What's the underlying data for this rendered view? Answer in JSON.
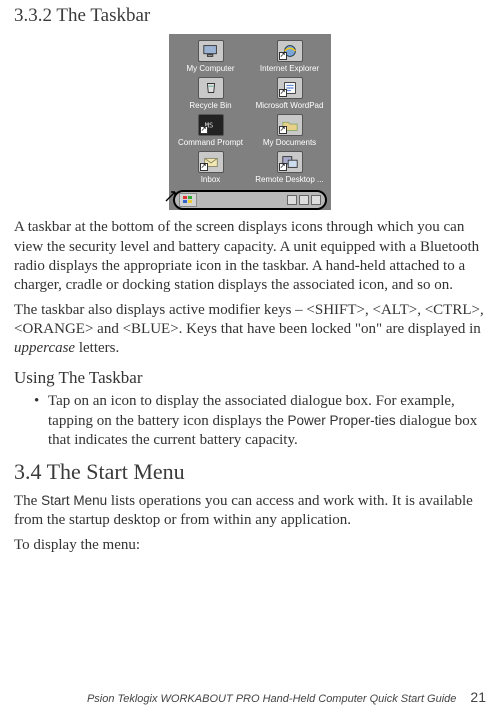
{
  "section332": {
    "heading": "3.3.2 The Taskbar",
    "screenshot": {
      "icons": [
        {
          "label": "My Computer",
          "glyph": "computer"
        },
        {
          "label": "Internet Explorer",
          "glyph": "ie"
        },
        {
          "label": "Recycle Bin",
          "glyph": "recycle"
        },
        {
          "label": "Microsoft WordPad",
          "glyph": "wordpad"
        },
        {
          "label": "Command Prompt",
          "glyph": "cmd"
        },
        {
          "label": "My Documents",
          "glyph": "folder"
        },
        {
          "label": "Inbox",
          "glyph": "inbox"
        },
        {
          "label": "Remote Desktop ...",
          "glyph": "rdp"
        }
      ]
    },
    "para1": "A taskbar at the bottom of the screen displays icons through which you can view the security level and battery capacity. A unit equipped with a Bluetooth radio displays the appropriate icon in the taskbar. A hand-held attached to a charger, cradle or docking station displays the associated icon, and so on.",
    "para2_a": "The taskbar also displays active modifier keys – <SHIFT>, <ALT>, <CTRL>, <ORANGE> and <BLUE>. Keys that have been locked \"on\" are displayed in ",
    "para2_i": "uppercase",
    "para2_b": " letters.",
    "using_heading": "Using The Taskbar",
    "bullet_a": "Tap on an icon to display the associated dialogue box. For example, tapping on the battery icon displays the ",
    "bullet_ui": "Power Proper-ties",
    "bullet_b": " dialogue box that indicates the current battery capacity."
  },
  "section34": {
    "heading": "3.4  The Start Menu",
    "para1_a": "The ",
    "para1_ui": "Start Menu",
    "para1_b": " lists operations you can access and work with. It is available from the startup desktop or from within any application.",
    "para2": "To display the menu:"
  },
  "footer": {
    "title": "Psion Teklogix WORKABOUT PRO Hand-Held Computer Quick Start Guide",
    "page": "21"
  }
}
